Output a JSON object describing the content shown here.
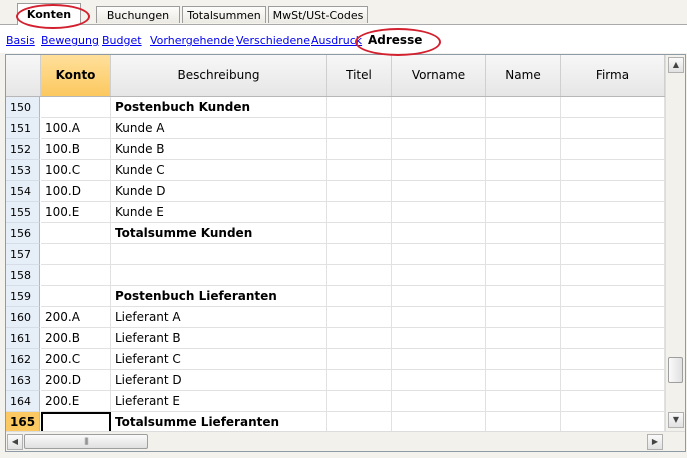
{
  "tabs": [
    {
      "label": "Konten",
      "active": true
    },
    {
      "label": "Buchungen",
      "active": false
    },
    {
      "label": "Totalsummen",
      "active": false
    },
    {
      "label": "MwSt/USt-Codes",
      "active": false
    }
  ],
  "views": [
    {
      "label": "Basis",
      "active": false
    },
    {
      "label": "Bewegung",
      "active": false
    },
    {
      "label": "Budget",
      "active": false
    },
    {
      "label": "Vorhergehende",
      "active": false
    },
    {
      "label": "Verschiedene",
      "active": false
    },
    {
      "label": "Ausdruck",
      "active": false
    },
    {
      "label": "Adresse",
      "active": true
    }
  ],
  "columns": [
    "Konto",
    "Beschreibung",
    "Titel",
    "Vorname",
    "Name",
    "Firma"
  ],
  "rows": [
    {
      "num": "150",
      "konto": "",
      "beschreibung": "Postenbuch Kunden",
      "bold": true
    },
    {
      "num": "151",
      "konto": "100.A",
      "beschreibung": "Kunde A",
      "bold": false
    },
    {
      "num": "152",
      "konto": "100.B",
      "beschreibung": "Kunde B",
      "bold": false
    },
    {
      "num": "153",
      "konto": "100.C",
      "beschreibung": "Kunde C",
      "bold": false
    },
    {
      "num": "154",
      "konto": "100.D",
      "beschreibung": "Kunde D",
      "bold": false
    },
    {
      "num": "155",
      "konto": "100.E",
      "beschreibung": "Kunde E",
      "bold": false
    },
    {
      "num": "156",
      "konto": "",
      "beschreibung": "Totalsumme Kunden",
      "bold": true
    },
    {
      "num": "157",
      "konto": "",
      "beschreibung": "",
      "bold": false
    },
    {
      "num": "158",
      "konto": "",
      "beschreibung": "",
      "bold": false
    },
    {
      "num": "159",
      "konto": "",
      "beschreibung": "Postenbuch Lieferanten",
      "bold": true
    },
    {
      "num": "160",
      "konto": "200.A",
      "beschreibung": "Lieferant A",
      "bold": false
    },
    {
      "num": "161",
      "konto": "200.B",
      "beschreibung": "Lieferant B",
      "bold": false
    },
    {
      "num": "162",
      "konto": "200.C",
      "beschreibung": "Lieferant C",
      "bold": false
    },
    {
      "num": "163",
      "konto": "200.D",
      "beschreibung": "Lieferant D",
      "bold": false
    },
    {
      "num": "164",
      "konto": "200.E",
      "beschreibung": "Lieferant E",
      "bold": false
    },
    {
      "num": "165",
      "konto": "",
      "beschreibung": "Totalsumme Lieferanten",
      "bold": true,
      "selected": true
    }
  ],
  "icons": {
    "scroll_up": "arrow-up-icon",
    "scroll_down": "arrow-down-icon",
    "scroll_left": "arrow-left-icon",
    "scroll_right": "arrow-right-icon"
  },
  "colors": {
    "accent_header": "#fcc85f",
    "link": "#0000ee",
    "highlight_circle": "#d2202f",
    "row_header": "#e6eef8"
  }
}
